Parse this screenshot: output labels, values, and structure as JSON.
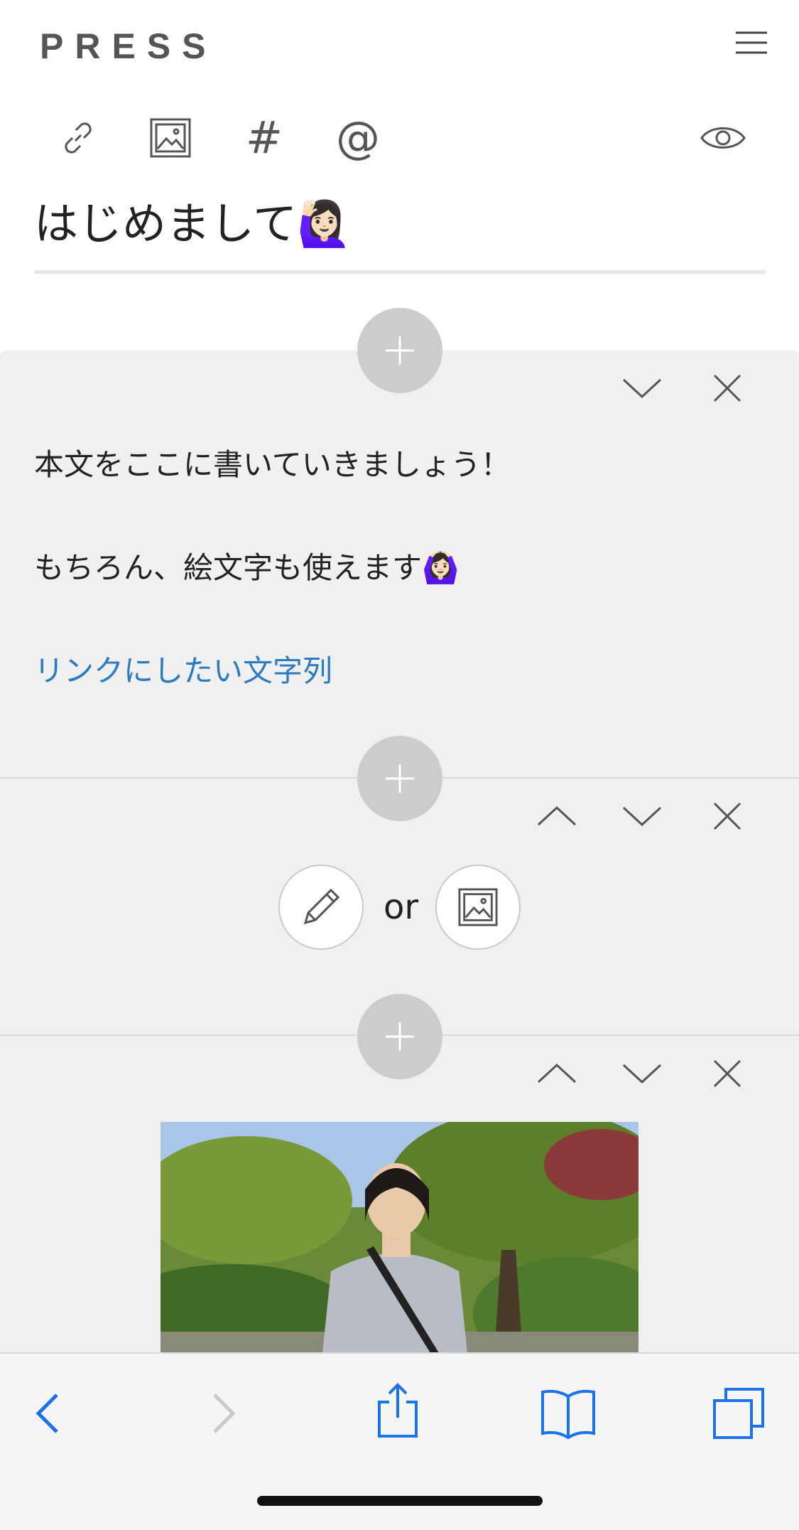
{
  "app": {
    "logo": "PRESS"
  },
  "editor": {
    "title": "はじめまして",
    "title_emoji": "🙋🏻‍♀️"
  },
  "text_block": {
    "line1": "本文をここに書いていきましょう！",
    "line2": "もちろん、絵文字も使えます",
    "line2_emoji": "🙆🏻‍♀️",
    "link": "リンクにしたい文字列",
    "link_color": "#2b7bc0"
  },
  "chooser_block": {
    "or_label": "or"
  },
  "toolbar": {
    "hashtag_label": "#",
    "mention_label": "@"
  },
  "colors": {
    "panel_bg": "#f0f0f1",
    "plus_bg": "#cccccc",
    "safari_blue": "#1a73e8"
  },
  "icons": {
    "toolbar": [
      "link-icon",
      "image-icon",
      "hashtag-icon",
      "mention-icon",
      "preview-eye-icon"
    ],
    "block_controls": [
      "chevron-up-icon",
      "chevron-down-icon",
      "close-icon"
    ],
    "safari": [
      "back-icon",
      "forward-icon",
      "share-icon",
      "bookmarks-icon",
      "tabs-icon"
    ]
  }
}
